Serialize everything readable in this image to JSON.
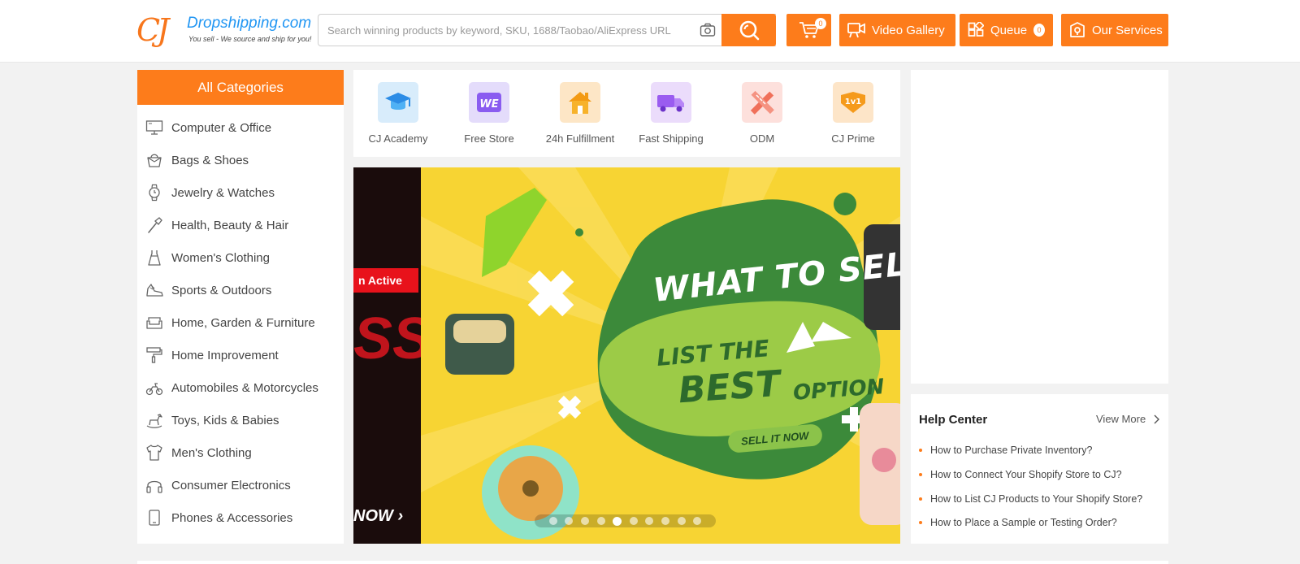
{
  "header": {
    "logo": {
      "mark": "CJ",
      "name": "Dropshipping.com",
      "tagline": "You sell - We source and ship for you!"
    },
    "search": {
      "placeholder": "Search winning products by keyword, SKU, 1688/Taobao/AliExpress URL"
    },
    "cart": {
      "count": "0"
    },
    "video_gallery": "Video Gallery",
    "queue": {
      "label": "Queue",
      "count": "0"
    },
    "our_services": "Our Services",
    "accent_color": "#fd7c1b"
  },
  "categories": {
    "title": "All Categories",
    "items": [
      {
        "label": "Computer & Office",
        "icon": "monitor-icon"
      },
      {
        "label": "Bags & Shoes",
        "icon": "bag-icon"
      },
      {
        "label": "Jewelry & Watches",
        "icon": "watch-icon"
      },
      {
        "label": "Health, Beauty & Hair",
        "icon": "brush-icon"
      },
      {
        "label": "Women's Clothing",
        "icon": "dress-icon"
      },
      {
        "label": "Sports & Outdoors",
        "icon": "sneaker-icon"
      },
      {
        "label": "Home, Garden & Furniture",
        "icon": "sofa-icon"
      },
      {
        "label": "Home Improvement",
        "icon": "paint-roller-icon"
      },
      {
        "label": "Automobiles & Motorcycles",
        "icon": "motorcycle-icon"
      },
      {
        "label": "Toys, Kids & Babies",
        "icon": "rocking-horse-icon"
      },
      {
        "label": "Men's Clothing",
        "icon": "shirt-icon"
      },
      {
        "label": "Consumer Electronics",
        "icon": "headphones-icon"
      },
      {
        "label": "Phones & Accessories",
        "icon": "phone-icon"
      }
    ]
  },
  "quick_links": [
    {
      "label": "CJ Academy",
      "icon": "graduation-cap-icon"
    },
    {
      "label": "Free Store",
      "icon": "we-store-icon"
    },
    {
      "label": "24h Fulfillment",
      "icon": "house-icon"
    },
    {
      "label": "Fast Shipping",
      "icon": "truck-icon"
    },
    {
      "label": "ODM",
      "icon": "ruler-icon"
    },
    {
      "label": "CJ Prime",
      "icon": "one-v-one-icon"
    }
  ],
  "banner": {
    "side_tag": "n Active",
    "side_text": "NOW",
    "headline": "WHAT TO SELL?",
    "line2": "LIST THE",
    "best": "BEST",
    "option": "OPTION",
    "cta": "SELL IT NOW",
    "slide_count": 10,
    "active_slide": 5
  },
  "help_center": {
    "title": "Help Center",
    "view_more": "View More",
    "items": [
      "How to Purchase Private Inventory?",
      "How to Connect Your Shopify Store to CJ?",
      "How to List CJ Products to Your Shopify Store?",
      "How to Place a Sample or Testing Order?"
    ]
  }
}
